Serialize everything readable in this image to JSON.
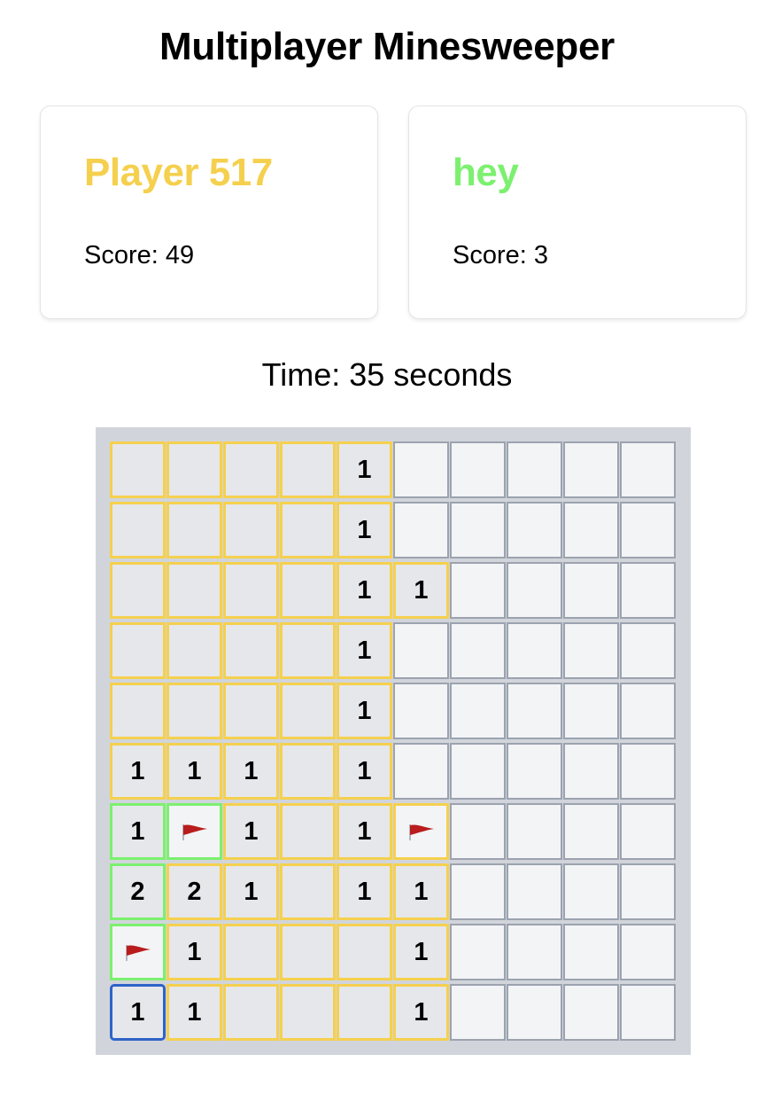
{
  "title": "Multiplayer Minesweeper",
  "players": [
    {
      "name": "Player 517",
      "score_text": "Score: 49",
      "color": "#f5d04e"
    },
    {
      "name": "hey",
      "score_text": "Score: 3",
      "color": "#7cf06f"
    }
  ],
  "timer_text": "Time: 35 seconds",
  "colors": {
    "board_bg": "#d1d5db",
    "unrevealed_bg": "#f3f4f6",
    "revealed_bg": "#e5e7eb",
    "default_border": "#9ca3af",
    "selected_border": "#2f63c8",
    "flag": "#b91c1c"
  },
  "board": {
    "rows": 10,
    "cols": 10,
    "selected": [
      9,
      0
    ],
    "cells": [
      [
        {
          "s": "r",
          "o": 1,
          "v": ""
        },
        {
          "s": "r",
          "o": 1,
          "v": ""
        },
        {
          "s": "r",
          "o": 1,
          "v": ""
        },
        {
          "s": "r",
          "o": 1,
          "v": ""
        },
        {
          "s": "r",
          "o": 1,
          "v": "1"
        },
        {
          "s": "u",
          "o": 0,
          "v": ""
        },
        {
          "s": "u",
          "o": 0,
          "v": ""
        },
        {
          "s": "u",
          "o": 0,
          "v": ""
        },
        {
          "s": "u",
          "o": 0,
          "v": ""
        },
        {
          "s": "u",
          "o": 0,
          "v": ""
        }
      ],
      [
        {
          "s": "r",
          "o": 1,
          "v": ""
        },
        {
          "s": "r",
          "o": 1,
          "v": ""
        },
        {
          "s": "r",
          "o": 1,
          "v": ""
        },
        {
          "s": "r",
          "o": 1,
          "v": ""
        },
        {
          "s": "r",
          "o": 1,
          "v": "1"
        },
        {
          "s": "u",
          "o": 0,
          "v": ""
        },
        {
          "s": "u",
          "o": 0,
          "v": ""
        },
        {
          "s": "u",
          "o": 0,
          "v": ""
        },
        {
          "s": "u",
          "o": 0,
          "v": ""
        },
        {
          "s": "u",
          "o": 0,
          "v": ""
        }
      ],
      [
        {
          "s": "r",
          "o": 1,
          "v": ""
        },
        {
          "s": "r",
          "o": 1,
          "v": ""
        },
        {
          "s": "r",
          "o": 1,
          "v": ""
        },
        {
          "s": "r",
          "o": 1,
          "v": ""
        },
        {
          "s": "r",
          "o": 1,
          "v": "1"
        },
        {
          "s": "r",
          "o": 1,
          "v": "1"
        },
        {
          "s": "u",
          "o": 0,
          "v": ""
        },
        {
          "s": "u",
          "o": 0,
          "v": ""
        },
        {
          "s": "u",
          "o": 0,
          "v": ""
        },
        {
          "s": "u",
          "o": 0,
          "v": ""
        }
      ],
      [
        {
          "s": "r",
          "o": 1,
          "v": ""
        },
        {
          "s": "r",
          "o": 1,
          "v": ""
        },
        {
          "s": "r",
          "o": 1,
          "v": ""
        },
        {
          "s": "r",
          "o": 1,
          "v": ""
        },
        {
          "s": "r",
          "o": 1,
          "v": "1"
        },
        {
          "s": "u",
          "o": 0,
          "v": ""
        },
        {
          "s": "u",
          "o": 0,
          "v": ""
        },
        {
          "s": "u",
          "o": 0,
          "v": ""
        },
        {
          "s": "u",
          "o": 0,
          "v": ""
        },
        {
          "s": "u",
          "o": 0,
          "v": ""
        }
      ],
      [
        {
          "s": "r",
          "o": 1,
          "v": ""
        },
        {
          "s": "r",
          "o": 1,
          "v": ""
        },
        {
          "s": "r",
          "o": 1,
          "v": ""
        },
        {
          "s": "r",
          "o": 1,
          "v": ""
        },
        {
          "s": "r",
          "o": 1,
          "v": "1"
        },
        {
          "s": "u",
          "o": 0,
          "v": ""
        },
        {
          "s": "u",
          "o": 0,
          "v": ""
        },
        {
          "s": "u",
          "o": 0,
          "v": ""
        },
        {
          "s": "u",
          "o": 0,
          "v": ""
        },
        {
          "s": "u",
          "o": 0,
          "v": ""
        }
      ],
      [
        {
          "s": "r",
          "o": 1,
          "v": "1"
        },
        {
          "s": "r",
          "o": 1,
          "v": "1"
        },
        {
          "s": "r",
          "o": 1,
          "v": "1"
        },
        {
          "s": "r",
          "o": 1,
          "v": ""
        },
        {
          "s": "r",
          "o": 1,
          "v": "1"
        },
        {
          "s": "u",
          "o": 0,
          "v": ""
        },
        {
          "s": "u",
          "o": 0,
          "v": ""
        },
        {
          "s": "u",
          "o": 0,
          "v": ""
        },
        {
          "s": "u",
          "o": 0,
          "v": ""
        },
        {
          "s": "u",
          "o": 0,
          "v": ""
        }
      ],
      [
        {
          "s": "r",
          "o": 2,
          "v": "1"
        },
        {
          "s": "f",
          "o": 2,
          "v": ""
        },
        {
          "s": "r",
          "o": 1,
          "v": "1"
        },
        {
          "s": "r",
          "o": 1,
          "v": ""
        },
        {
          "s": "r",
          "o": 1,
          "v": "1"
        },
        {
          "s": "f",
          "o": 1,
          "v": ""
        },
        {
          "s": "u",
          "o": 0,
          "v": ""
        },
        {
          "s": "u",
          "o": 0,
          "v": ""
        },
        {
          "s": "u",
          "o": 0,
          "v": ""
        },
        {
          "s": "u",
          "o": 0,
          "v": ""
        }
      ],
      [
        {
          "s": "r",
          "o": 2,
          "v": "2"
        },
        {
          "s": "r",
          "o": 1,
          "v": "2"
        },
        {
          "s": "r",
          "o": 1,
          "v": "1"
        },
        {
          "s": "r",
          "o": 1,
          "v": ""
        },
        {
          "s": "r",
          "o": 1,
          "v": "1"
        },
        {
          "s": "r",
          "o": 1,
          "v": "1"
        },
        {
          "s": "u",
          "o": 0,
          "v": ""
        },
        {
          "s": "u",
          "o": 0,
          "v": ""
        },
        {
          "s": "u",
          "o": 0,
          "v": ""
        },
        {
          "s": "u",
          "o": 0,
          "v": ""
        }
      ],
      [
        {
          "s": "f",
          "o": 2,
          "v": ""
        },
        {
          "s": "r",
          "o": 1,
          "v": "1"
        },
        {
          "s": "r",
          "o": 1,
          "v": ""
        },
        {
          "s": "r",
          "o": 1,
          "v": ""
        },
        {
          "s": "r",
          "o": 1,
          "v": ""
        },
        {
          "s": "r",
          "o": 1,
          "v": "1"
        },
        {
          "s": "u",
          "o": 0,
          "v": ""
        },
        {
          "s": "u",
          "o": 0,
          "v": ""
        },
        {
          "s": "u",
          "o": 0,
          "v": ""
        },
        {
          "s": "u",
          "o": 0,
          "v": ""
        }
      ],
      [
        {
          "s": "r",
          "o": 3,
          "v": "1"
        },
        {
          "s": "r",
          "o": 1,
          "v": "1"
        },
        {
          "s": "r",
          "o": 1,
          "v": ""
        },
        {
          "s": "r",
          "o": 1,
          "v": ""
        },
        {
          "s": "r",
          "o": 1,
          "v": ""
        },
        {
          "s": "r",
          "o": 1,
          "v": "1"
        },
        {
          "s": "u",
          "o": 0,
          "v": ""
        },
        {
          "s": "u",
          "o": 0,
          "v": ""
        },
        {
          "s": "u",
          "o": 0,
          "v": ""
        },
        {
          "s": "u",
          "o": 0,
          "v": ""
        }
      ]
    ]
  }
}
